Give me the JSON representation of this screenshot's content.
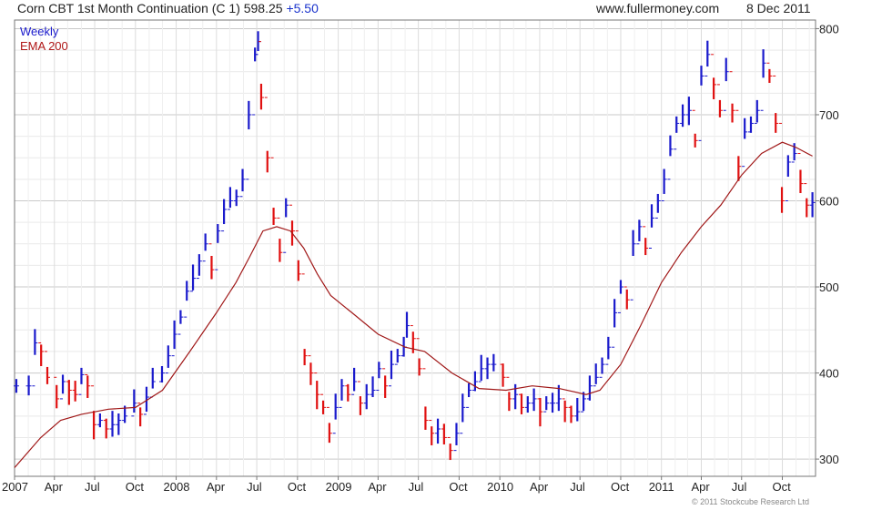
{
  "header": {
    "title": "Corn CBT 1st Month Continuation (C 1) 598.25",
    "change": "+5.50",
    "site": "www.fullermoney.com",
    "date": "8 Dec 2011"
  },
  "legend": {
    "weekly": "Weekly",
    "ema": "EMA 200"
  },
  "copyright": "© 2011 Stockcube Research Ltd",
  "chart_data": {
    "type": "line",
    "title": "Corn CBT 1st Month Continuation (C 1) 598.25 +5.50",
    "xlabel": "",
    "ylabel": "",
    "ylim": [
      280,
      810
    ],
    "xlim": [
      "2007-01-01",
      "2011-12-15"
    ],
    "grid": true,
    "legend_position": "top-left",
    "y_ticks": [
      300,
      400,
      500,
      600,
      700,
      800
    ],
    "x_ticks": [
      {
        "date": "2007-01-01",
        "label": "2007"
      },
      {
        "date": "2007-04-01",
        "label": "Apr"
      },
      {
        "date": "2007-07-01",
        "label": "Jul"
      },
      {
        "date": "2007-10-01",
        "label": "Oct"
      },
      {
        "date": "2008-01-01",
        "label": "2008"
      },
      {
        "date": "2008-04-01",
        "label": "Apr"
      },
      {
        "date": "2008-07-01",
        "label": "Jul"
      },
      {
        "date": "2008-10-01",
        "label": "Oct"
      },
      {
        "date": "2009-01-01",
        "label": "2009"
      },
      {
        "date": "2009-04-01",
        "label": "Apr"
      },
      {
        "date": "2009-07-01",
        "label": "Jul"
      },
      {
        "date": "2009-10-01",
        "label": "Oct"
      },
      {
        "date": "2010-01-01",
        "label": "2010"
      },
      {
        "date": "2010-04-01",
        "label": "Apr"
      },
      {
        "date": "2010-07-01",
        "label": "Jul"
      },
      {
        "date": "2010-10-01",
        "label": "Oct"
      },
      {
        "date": "2011-01-01",
        "label": "2011"
      },
      {
        "date": "2011-04-01",
        "label": "Apr"
      },
      {
        "date": "2011-07-01",
        "label": "Jul"
      },
      {
        "date": "2011-10-01",
        "label": "Oct"
      }
    ],
    "series": [
      {
        "name": "Weekly",
        "up_color": "#1a1acc",
        "down_color": "#e01010",
        "points": [
          [
            "2007-01-05",
            385
          ],
          [
            "2007-02-02",
            385
          ],
          [
            "2007-02-16",
            435
          ],
          [
            "2007-03-02",
            425
          ],
          [
            "2007-03-16",
            395
          ],
          [
            "2007-04-06",
            370
          ],
          [
            "2007-04-20",
            390
          ],
          [
            "2007-05-04",
            380
          ],
          [
            "2007-05-18",
            375
          ],
          [
            "2007-06-01",
            398
          ],
          [
            "2007-06-15",
            385
          ],
          [
            "2007-06-29",
            340
          ],
          [
            "2007-07-13",
            345
          ],
          [
            "2007-07-27",
            335
          ],
          [
            "2007-08-10",
            340
          ],
          [
            "2007-08-24",
            345
          ],
          [
            "2007-09-07",
            350
          ],
          [
            "2007-09-28",
            365
          ],
          [
            "2007-10-12",
            352
          ],
          [
            "2007-10-26",
            372
          ],
          [
            "2007-11-09",
            390
          ],
          [
            "2007-11-30",
            400
          ],
          [
            "2007-12-14",
            420
          ],
          [
            "2007-12-28",
            445
          ],
          [
            "2008-01-11",
            465
          ],
          [
            "2008-01-25",
            495
          ],
          [
            "2008-02-08",
            510
          ],
          [
            "2008-02-22",
            530
          ],
          [
            "2008-03-07",
            550
          ],
          [
            "2008-03-21",
            520
          ],
          [
            "2008-04-04",
            565
          ],
          [
            "2008-04-18",
            590
          ],
          [
            "2008-05-02",
            600
          ],
          [
            "2008-05-16",
            605
          ],
          [
            "2008-05-30",
            625
          ],
          [
            "2008-06-13",
            700
          ],
          [
            "2008-06-27",
            770
          ],
          [
            "2008-07-04",
            785
          ],
          [
            "2008-07-11",
            720
          ],
          [
            "2008-07-25",
            650
          ],
          [
            "2008-08-08",
            580
          ],
          [
            "2008-08-22",
            540
          ],
          [
            "2008-09-05",
            595
          ],
          [
            "2008-09-19",
            565
          ],
          [
            "2008-10-03",
            515
          ],
          [
            "2008-10-17",
            420
          ],
          [
            "2008-10-31",
            400
          ],
          [
            "2008-11-14",
            375
          ],
          [
            "2008-11-28",
            360
          ],
          [
            "2008-12-12",
            330
          ],
          [
            "2008-12-26",
            360
          ],
          [
            "2009-01-09",
            385
          ],
          [
            "2009-01-23",
            375
          ],
          [
            "2009-02-06",
            390
          ],
          [
            "2009-02-20",
            365
          ],
          [
            "2009-03-06",
            375
          ],
          [
            "2009-03-20",
            380
          ],
          [
            "2009-04-03",
            405
          ],
          [
            "2009-04-17",
            385
          ],
          [
            "2009-05-01",
            410
          ],
          [
            "2009-05-15",
            420
          ],
          [
            "2009-05-29",
            430
          ],
          [
            "2009-06-05",
            455
          ],
          [
            "2009-06-19",
            440
          ],
          [
            "2009-07-03",
            405
          ],
          [
            "2009-07-17",
            345
          ],
          [
            "2009-07-31",
            330
          ],
          [
            "2009-08-14",
            335
          ],
          [
            "2009-08-28",
            325
          ],
          [
            "2009-09-11",
            310
          ],
          [
            "2009-09-25",
            330
          ],
          [
            "2009-10-09",
            360
          ],
          [
            "2009-10-23",
            380
          ],
          [
            "2009-11-06",
            390
          ],
          [
            "2009-11-20",
            405
          ],
          [
            "2009-12-04",
            410
          ],
          [
            "2009-12-18",
            410
          ],
          [
            "2010-01-08",
            395
          ],
          [
            "2010-01-22",
            370
          ],
          [
            "2010-02-05",
            375
          ],
          [
            "2010-02-19",
            360
          ],
          [
            "2010-03-05",
            365
          ],
          [
            "2010-03-19",
            370
          ],
          [
            "2010-04-02",
            355
          ],
          [
            "2010-04-16",
            365
          ],
          [
            "2010-04-30",
            365
          ],
          [
            "2010-05-14",
            370
          ],
          [
            "2010-05-28",
            360
          ],
          [
            "2010-06-11",
            350
          ],
          [
            "2010-06-25",
            355
          ],
          [
            "2010-07-09",
            370
          ],
          [
            "2010-07-23",
            385
          ],
          [
            "2010-08-06",
            395
          ],
          [
            "2010-08-20",
            410
          ],
          [
            "2010-09-03",
            430
          ],
          [
            "2010-09-17",
            470
          ],
          [
            "2010-10-01",
            500
          ],
          [
            "2010-10-15",
            485
          ],
          [
            "2010-10-29",
            550
          ],
          [
            "2010-11-12",
            570
          ],
          [
            "2010-11-26",
            545
          ],
          [
            "2010-12-10",
            580
          ],
          [
            "2010-12-24",
            600
          ],
          [
            "2011-01-07",
            625
          ],
          [
            "2011-01-21",
            660
          ],
          [
            "2011-02-04",
            690
          ],
          [
            "2011-02-18",
            700
          ],
          [
            "2011-03-04",
            705
          ],
          [
            "2011-03-18",
            670
          ],
          [
            "2011-04-01",
            745
          ],
          [
            "2011-04-15",
            770
          ],
          [
            "2011-04-29",
            735
          ],
          [
            "2011-05-13",
            705
          ],
          [
            "2011-05-27",
            750
          ],
          [
            "2011-06-10",
            705
          ],
          [
            "2011-06-24",
            640
          ],
          [
            "2011-07-08",
            680
          ],
          [
            "2011-07-22",
            690
          ],
          [
            "2011-08-05",
            705
          ],
          [
            "2011-08-19",
            760
          ],
          [
            "2011-09-02",
            745
          ],
          [
            "2011-09-16",
            690
          ],
          [
            "2011-09-30",
            600
          ],
          [
            "2011-10-14",
            645
          ],
          [
            "2011-10-28",
            655
          ],
          [
            "2011-11-11",
            620
          ],
          [
            "2011-11-25",
            595
          ],
          [
            "2011-12-08",
            598
          ]
        ]
      },
      {
        "name": "EMA 200",
        "color": "#a01818",
        "points": [
          [
            "2007-01-01",
            290
          ],
          [
            "2007-03-01",
            325
          ],
          [
            "2007-04-15",
            345
          ],
          [
            "2007-06-01",
            352
          ],
          [
            "2007-08-01",
            358
          ],
          [
            "2007-10-01",
            360
          ],
          [
            "2007-12-01",
            380
          ],
          [
            "2008-02-01",
            425
          ],
          [
            "2008-04-01",
            470
          ],
          [
            "2008-05-15",
            505
          ],
          [
            "2008-06-15",
            535
          ],
          [
            "2008-07-15",
            565
          ],
          [
            "2008-08-15",
            570
          ],
          [
            "2008-09-15",
            565
          ],
          [
            "2008-10-15",
            545
          ],
          [
            "2008-11-15",
            515
          ],
          [
            "2008-12-15",
            490
          ],
          [
            "2009-02-01",
            470
          ],
          [
            "2009-04-01",
            445
          ],
          [
            "2009-06-01",
            430
          ],
          [
            "2009-07-15",
            425
          ],
          [
            "2009-09-15",
            400
          ],
          [
            "2009-11-15",
            382
          ],
          [
            "2010-01-15",
            380
          ],
          [
            "2010-03-15",
            385
          ],
          [
            "2010-05-15",
            382
          ],
          [
            "2010-07-15",
            375
          ],
          [
            "2010-08-15",
            380
          ],
          [
            "2010-10-01",
            410
          ],
          [
            "2010-11-15",
            455
          ],
          [
            "2011-01-01",
            505
          ],
          [
            "2011-02-15",
            540
          ],
          [
            "2011-04-01",
            570
          ],
          [
            "2011-05-15",
            595
          ],
          [
            "2011-07-01",
            630
          ],
          [
            "2011-08-15",
            655
          ],
          [
            "2011-10-01",
            668
          ],
          [
            "2011-11-01",
            662
          ],
          [
            "2011-12-08",
            652
          ]
        ]
      }
    ]
  }
}
